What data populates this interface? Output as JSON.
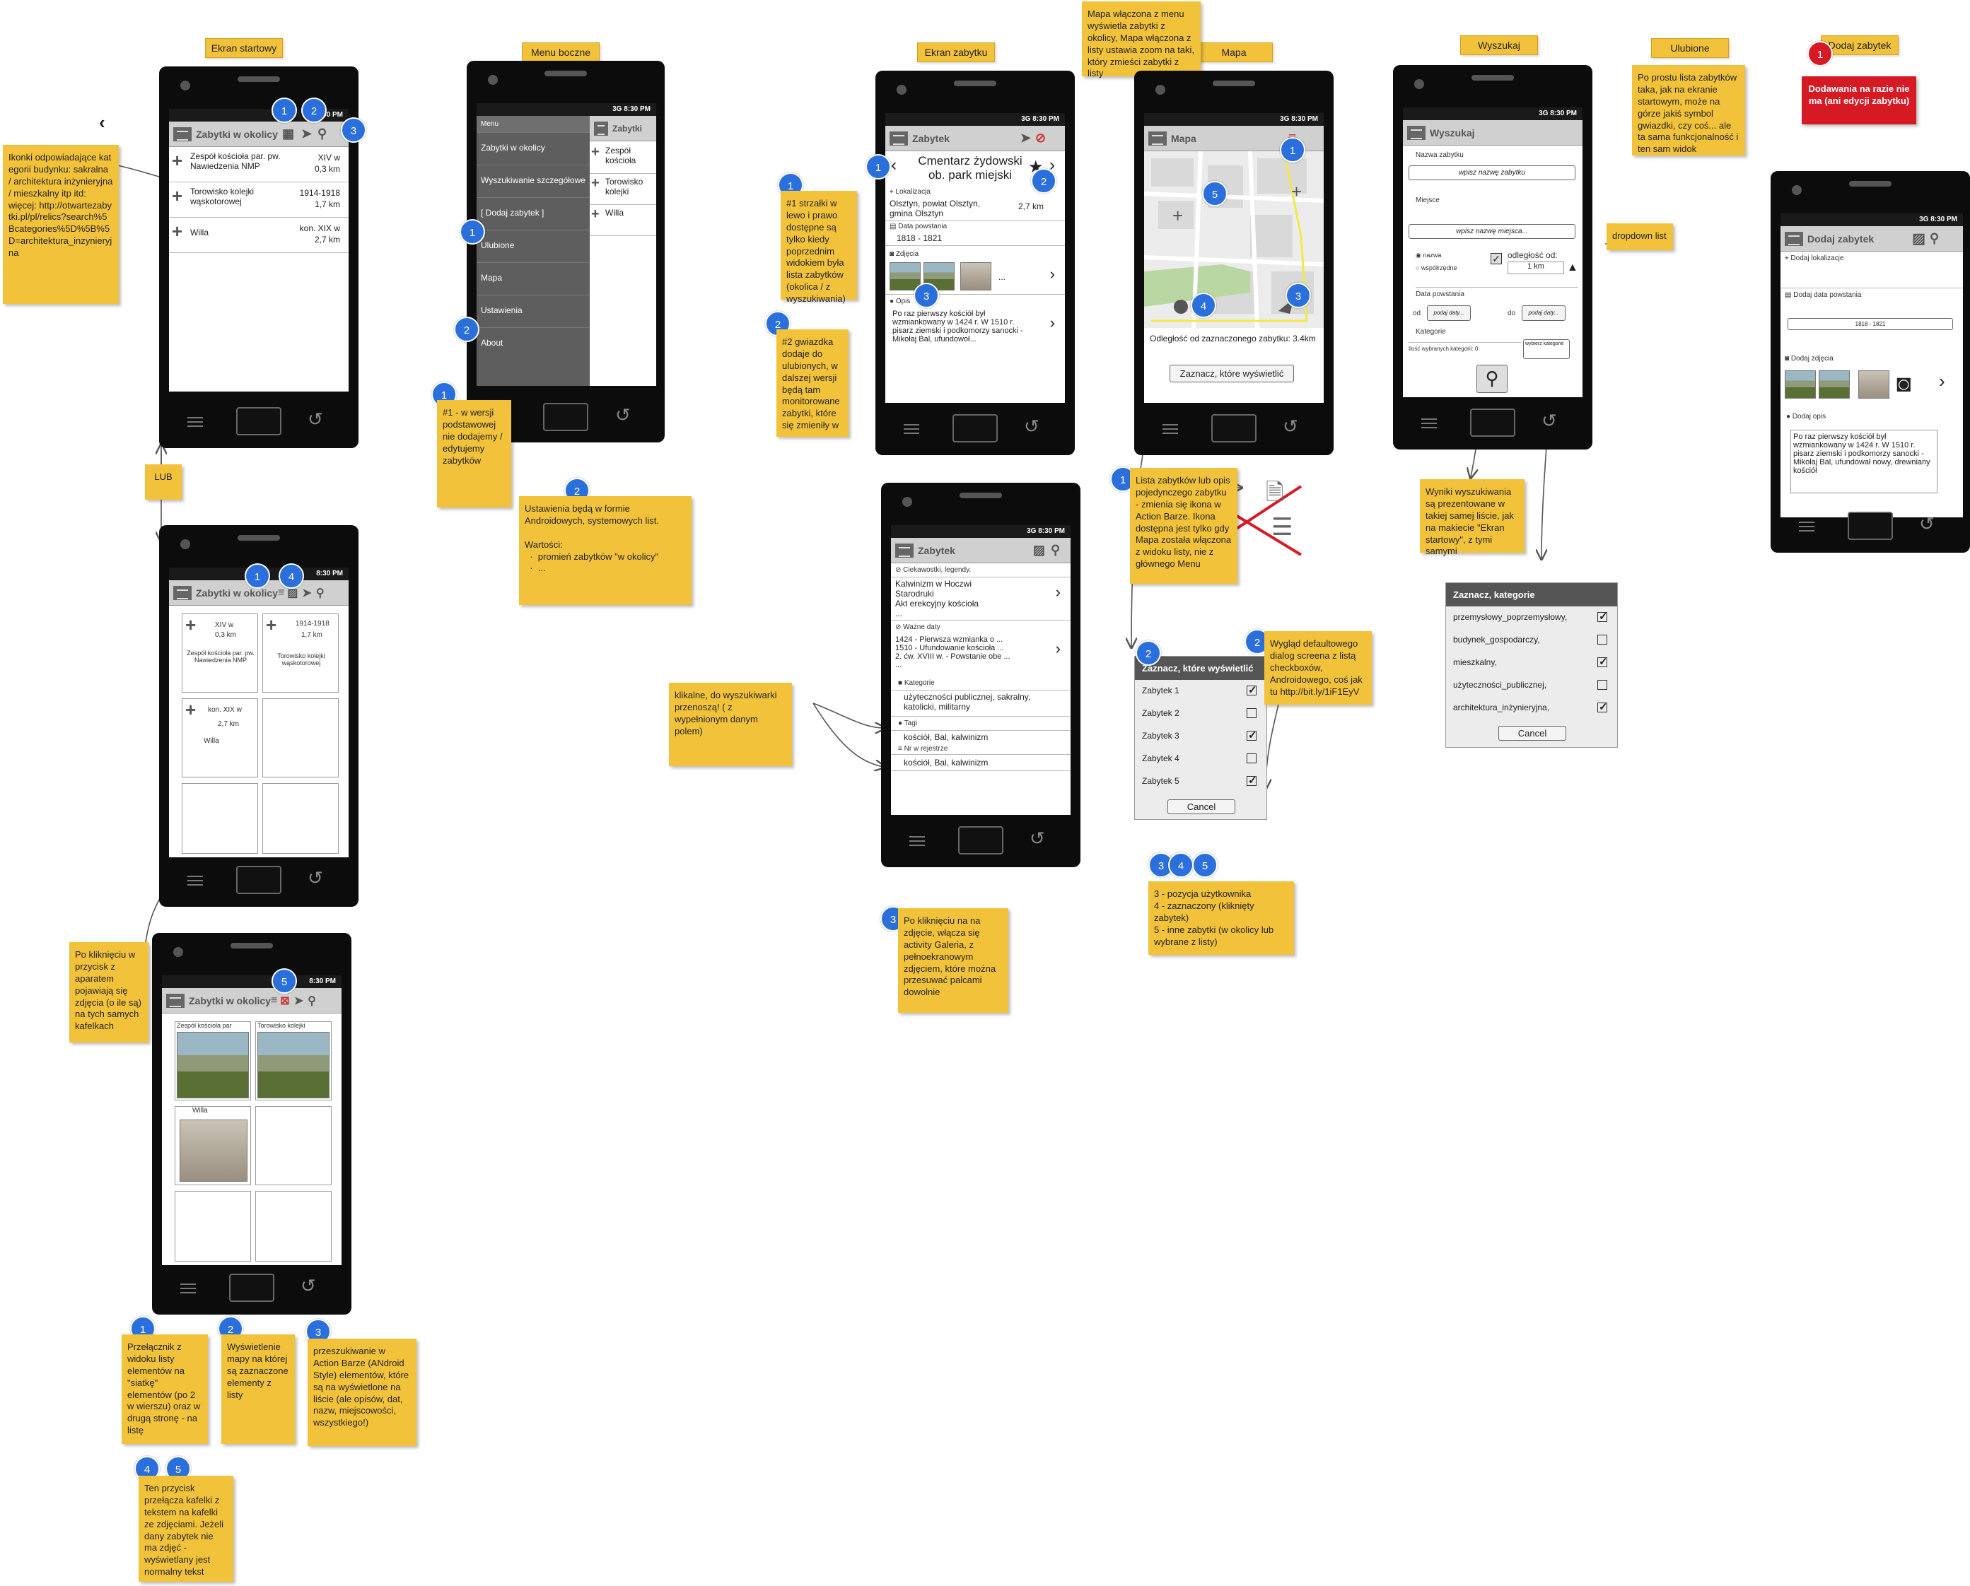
{
  "tags": {
    "start": "Ekran startowy",
    "side": "Menu boczne",
    "monument": "Ekran zabytku",
    "map": "Mapa",
    "search": "Wyszukaj",
    "fav": "Ulubione",
    "add": "Dodaj zabytek"
  },
  "status": {
    "net": "3G",
    "time": "8:30 PM"
  },
  "start": {
    "title": "Zabytki w okolicy",
    "items": [
      {
        "name": "Zespół kościoła par. pw. Nawiedzenia NMP",
        "date": "XIV w",
        "dist": "0,3 km"
      },
      {
        "name": "Torowisko kolejki wąskotorowej",
        "date": "1914-1918",
        "dist": "1,7 km"
      },
      {
        "name": "Willa",
        "date": "kon. XIX w",
        "dist": "2,7 km"
      }
    ]
  },
  "grid": {
    "title": "Zabytki w okolicy",
    "tiles": [
      {
        "date": "XIV w",
        "dist": "0,3 km",
        "name": "Zespół kościoła par. pw. Nawiedzenia NMP"
      },
      {
        "date": "1914-1918",
        "dist": "1,7 km",
        "name": "Torowisko kolejki wąskotorowej"
      },
      {
        "date": "kon. XIX w",
        "dist": "2,7 km",
        "name": "Willa"
      }
    ]
  },
  "photo": {
    "title": "Zabytki w okolicy",
    "tiles": [
      "Zespół kościoła par",
      "Torowisko kolejki",
      "Willa"
    ]
  },
  "side": {
    "title": "Zabytki",
    "header": "Menu",
    "items": [
      "Zabytki w okolicy",
      "Wyszukiwanie szczegółowe",
      "[ Dodaj zabytek ]",
      "Ulubione",
      "Mapa",
      "Ustawienia",
      "About"
    ],
    "list": [
      "Zespół kościoła",
      "Torowisko kolejki",
      "Willa"
    ]
  },
  "monument": {
    "title": "Zabytek",
    "name": "Cmentarz żydowski ob. park miejski",
    "loc_label": "Lokalizacja",
    "loc": "Olsztyn, powiat Olsztyn, gmina Olsztyn",
    "dist": "2,7 km",
    "date_label": "Data powstania",
    "date": "1818 - 1821",
    "photos_label": "Zdjęcia",
    "more": "...",
    "desc_label": "Opis",
    "desc": "Po raz pierwszy kościół był wzmiankowany w 1424 r. W 1510 r. pisarz ziemski i podkomorzy sanocki - Mikołaj Bal, ufundowoł..."
  },
  "monument2": {
    "title": "Zabytek",
    "cur_label": "Ciekawostki, legendy.",
    "cur": "Kalwinizm w Hoczwi\nStarodruki\nAkt erekcyjny kościoła\n...",
    "dates_label": "Ważne daty",
    "dates": "1424 - Pierwsza wzmianka o ...\n1510 - Ufundowanie kościoła ...\n2. ćw. XVIII w. - Powstanie obe ...\n...",
    "cat_label": "Kategorie",
    "cat": "użyteczności publicznej, sakralny, katolicki, militarny",
    "tags_label": "Tagi",
    "tags": "kościół, Bal, kalwinizm",
    "reg_label": "Nr w rejestrze",
    "reg": "kościół, Bal, kalwinizm"
  },
  "map": {
    "title": "Mapa",
    "dist": "Odległość od zaznaczonego zabytku: 3.4km",
    "btn": "Zaznacz, które wyświetlić"
  },
  "mapdlg": {
    "title": "Zaznacz, które wyświetlić",
    "items": [
      "Zabytek 1",
      "Zabytek 2",
      "Zabytek 3",
      "Zabytek 4",
      "Zabytek 5"
    ],
    "checked": [
      true,
      false,
      true,
      false,
      true
    ],
    "cancel": "Cancel"
  },
  "search": {
    "title": "Wyszukaj",
    "name_label": "Nazwa zabytku",
    "name_ph": "wpisz nazwę zabytku",
    "place_label": "Miejsce",
    "place_ph": "wpisz nazwę miejsca...",
    "r1": "nazwa",
    "r2": "współrzędne",
    "dist_label": "odległość od:",
    "dist": "1 km",
    "date_label": "Data powstania",
    "from": "od",
    "to": "do",
    "date_ph": "podaj daty...",
    "cat_label": "Kategorie",
    "cat_count": "Ilość wybranych kategorii: 0",
    "cat_btn": "wybierz kategorie"
  },
  "catdlg": {
    "title": "Zaznacz, kategorie",
    "items": [
      "przemysłowy_poprzemysłowy,",
      "budynek_gospodarczy,",
      "mieszkalny,",
      "użyteczności_publicznej,",
      "architektura_inżynieryjna,"
    ],
    "checked": [
      true,
      false,
      true,
      false,
      true
    ],
    "cancel": "Cancel"
  },
  "add": {
    "title": "Dodaj zabytek",
    "loc": "Dodaj lokalizacje",
    "date": "Dodaj data powstania",
    "date_val": "1818 - 1821",
    "photo": "Dodaj zdjęcia",
    "desc": "Dodaj opis",
    "desc_text": "Po raz pierwszy kościół był wzmiankowany w 1424 r. W 1510 r. pisarz ziemski i podkomorzy sanocki - Mikołaj Bal, ufundował nowy, drewniany kościół"
  },
  "notes": {
    "icons": "Ikonki odpowiadające kategorii budynku: sakralna / architektura inżynieryjna / mieszkalny itp itd:\nwięcej: http://otwartezabytki.pl/pl/relics?search%5Bcategories%5D%5B%5D=architektura_inzynieryjna",
    "lub": "LUB",
    "click_photo": "Po kliknięciu w przycisk z aparatem pojawiają się zdjęcia (o ile są) na tych samych kafelkach",
    "n1": "Przełącznik z widoku listy elementów na \"siatkę\" elementów (po 2 w wierszu) oraz w drugą stronę - na listę",
    "n2": "Wyświetlenie mapy na której są zaznaczone elementy z listy",
    "n3": "przeszukiwanie w Action Barze (ANdroid Style) elementów, które są na wyświetlone na liście (ale opisów, dat, nazw, miejscowości, wszystkiego!)",
    "n45": "Ten przycisk przełącza kafelki z tekstem na kafelki ze zdjęciami. Jeżeli dany zabytek nie ma zdjęć - wyświetlany jest normalny tekst",
    "side1": "#1 - w wersji podstawowej nie dodajemy / edytujemy zabytków",
    "side2": "Ustawienia będą w formie Androidowych, systemowych list.\n\nWartości:\n  ·  promień zabytków \"w okolicy\"\n  ·  ...",
    "mon1": "#1 strzałki w lewo i prawo dostępne są tylko kiedy poprzednim widokiem była lista zabytków (okolica / z wyszukiwania)",
    "mon2": "#2 gwiazdka dodaje do ulubionych, w dalszej wersji będą tam monitorowane zabytki, które się zmieniły w",
    "mon3": "Po kliknięciu na na zdjęcie, włącza się activity Galeria, z pełnoekranowym zdjęciem, które można przesuwać palcami dowolnie",
    "clickable": "klikalne, do wyszukiwarki przenoszą! ( z wypełnionym danym polem)",
    "map_top": "Mapa włączona z menu wyświetla zabytki z okolicy, Mapa włączona z listy ustawia zoom na taki, który zmieści zabytki z listy",
    "map1": "Lista zabytków lub opis pojedynczego zabytku - zmienia się ikona w Action Barze. Ikona dostępna jest tylko gdy Mapa została włączona z widoku listy, nie z głównego Menu",
    "map2": "Wygląd defaultowego dialog screena z listą checkboxów, Androidowego, coś jak tu http://bit.ly/1iF1EyV",
    "map345": "3 - pozycja użytkownika\n4 - zaznaczony (kliknięty zabytek)\n5 - inne zabytki (w okolicy lub wybrane z listy)",
    "search_res": "Wyniki wyszukiwania są prezentowane w takiej samej liście, jak na makiecie \"Ekran startowy\", z tymi samymi",
    "dropdown": "dropdown list",
    "fav": "Po prostu lista zabytków taka, jak na ekranie startowym, może na górze jakiś symbol gwiazdki, czy coś... ale ta sama funkcjonalność i ten sam widok",
    "add": "Dodawania na razie nie ma (ani edycji zabytku)"
  }
}
